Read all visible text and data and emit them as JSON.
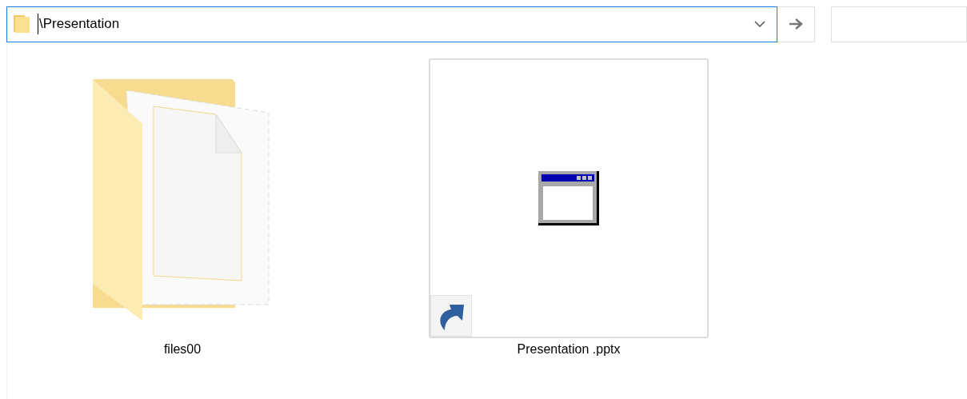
{
  "address_bar": {
    "value": "\\Presentation"
  },
  "items": [
    {
      "kind": "folder",
      "label": "files00",
      "selected": false
    },
    {
      "kind": "shortcut",
      "label": "Presentation .pptx",
      "selected": true
    }
  ]
}
